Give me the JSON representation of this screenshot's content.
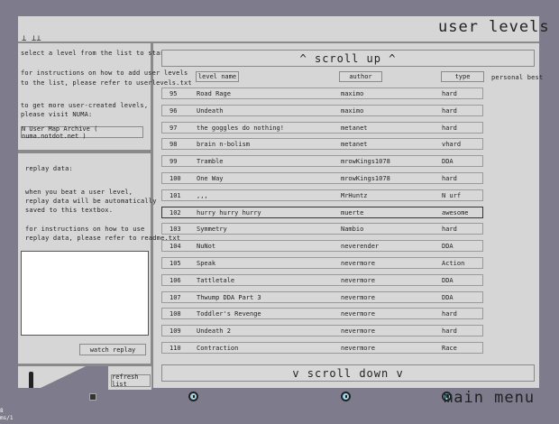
{
  "title": "user levels",
  "instructions": {
    "line1": "select a level from the list to start playing.",
    "line2": "for instructions on how to add user levels",
    "line3": "to the list, please refer to userlevels.txt",
    "line4": "to get more user-created levels,",
    "line5": "please visit NUMA:",
    "archive_button": "N User Map Archive ( numa.notdot.net )"
  },
  "replay": {
    "title": "replay data:",
    "line1": "when you beat a user level,",
    "line2": "replay data will be automatically",
    "line3": "saved to this textbox.",
    "line4": "for instructions on how to use",
    "line5": "replay data, please refer to readme.txt",
    "textbox_value": "",
    "watch_button": "watch replay"
  },
  "refresh_button": "refresh list",
  "scroll_up": "^ scroll up ^",
  "scroll_down": "v scroll down v",
  "columns": {
    "level_name": "level name",
    "author": "author",
    "type": "type",
    "personal_best": "personal best"
  },
  "rows": [
    {
      "num": "95",
      "name": "Road Rage",
      "author": "maximo",
      "type": "hard"
    },
    {
      "num": "96",
      "name": "Undeath",
      "author": "maximo",
      "type": "hard"
    },
    {
      "num": "97",
      "name": "the goggles do nothing!",
      "author": "metanet",
      "type": "hard"
    },
    {
      "num": "98",
      "name": "brain n-bolism",
      "author": "metanet",
      "type": "vhard"
    },
    {
      "num": "99",
      "name": "Tramble",
      "author": "mrowKings1078",
      "type": "DDA"
    },
    {
      "num": "100",
      "name": "One Way",
      "author": "mrowKings1078",
      "type": "hard"
    },
    {
      "num": "101",
      "name": ",,,",
      "author": "MrHuntz",
      "type": "N urf"
    },
    {
      "num": "102",
      "name": "hurry hurry hurry",
      "author": "muerte",
      "type": "awesome"
    },
    {
      "num": "103",
      "name": "Symmetry",
      "author": "Nambio",
      "type": "hard"
    },
    {
      "num": "104",
      "name": "NuNot",
      "author": "neverender",
      "type": "DDA"
    },
    {
      "num": "105",
      "name": "Speak",
      "author": "nevermore",
      "type": "Action"
    },
    {
      "num": "106",
      "name": "Tattletale",
      "author": "nevermore",
      "type": "DDA"
    },
    {
      "num": "107",
      "name": "Thwump DDA Part 3",
      "author": "nevermore",
      "type": "DDA"
    },
    {
      "num": "108",
      "name": "Toddler's Revenge",
      "author": "nevermore",
      "type": "hard"
    },
    {
      "num": "109",
      "name": "Undeath 2",
      "author": "nevermore",
      "type": "hard"
    },
    {
      "num": "110",
      "name": "Contraction",
      "author": "nevermore",
      "type": "Race"
    }
  ],
  "selected_row": "102",
  "main_menu": "main menu",
  "fps": {
    "line1": "8",
    "line2": "ms/1"
  }
}
